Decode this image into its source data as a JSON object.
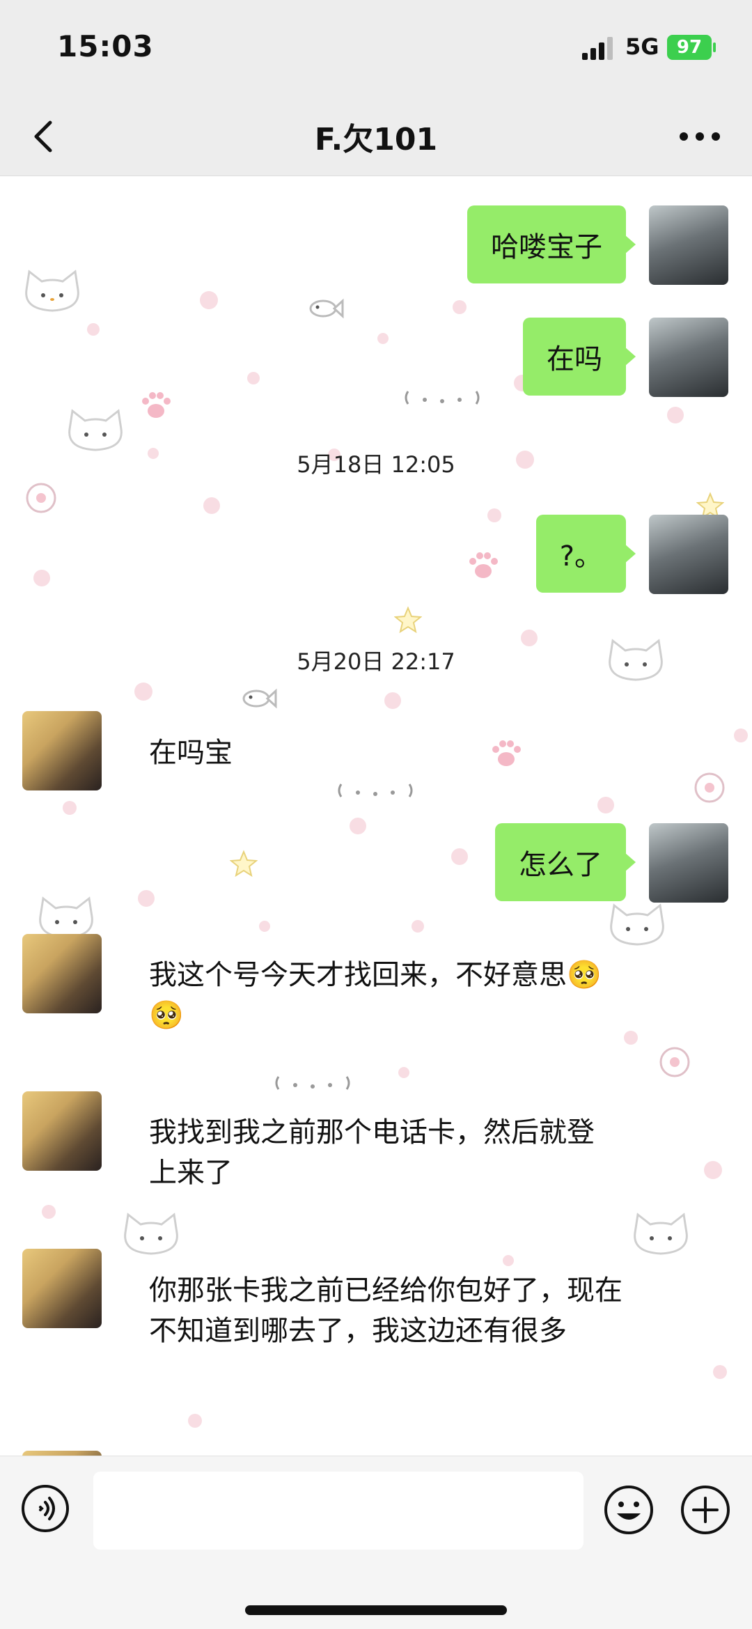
{
  "status_bar": {
    "time": "15:03",
    "network": "5G",
    "battery": "97"
  },
  "header": {
    "title": "F.欠101"
  },
  "messages": {
    "out_1": "哈喽宝子",
    "out_2": "在吗",
    "ts_1": "5月18日 12:05",
    "out_3": "?。",
    "ts_2": "5月20日 22:17",
    "in_1": "在吗宝",
    "out_4": "怎么了",
    "in_2": "我这个号今天才找回来，不好意思🥺🥺",
    "in_3": "我找到我之前那个电话卡，然后就登上来了",
    "in_4": "你那张卡我之前已经给你包好了，现在不知道到哪去了，我这边还有很多"
  },
  "colors": {
    "outgoing_bubble": "#95ec69",
    "bar_bg": "#ededed",
    "battery": "#3ccf4e"
  },
  "icons": {
    "back": "chevron-left-icon",
    "more": "more-dots-icon",
    "voice": "voice-icon",
    "emoji": "emoji-icon",
    "plus": "plus-icon"
  }
}
